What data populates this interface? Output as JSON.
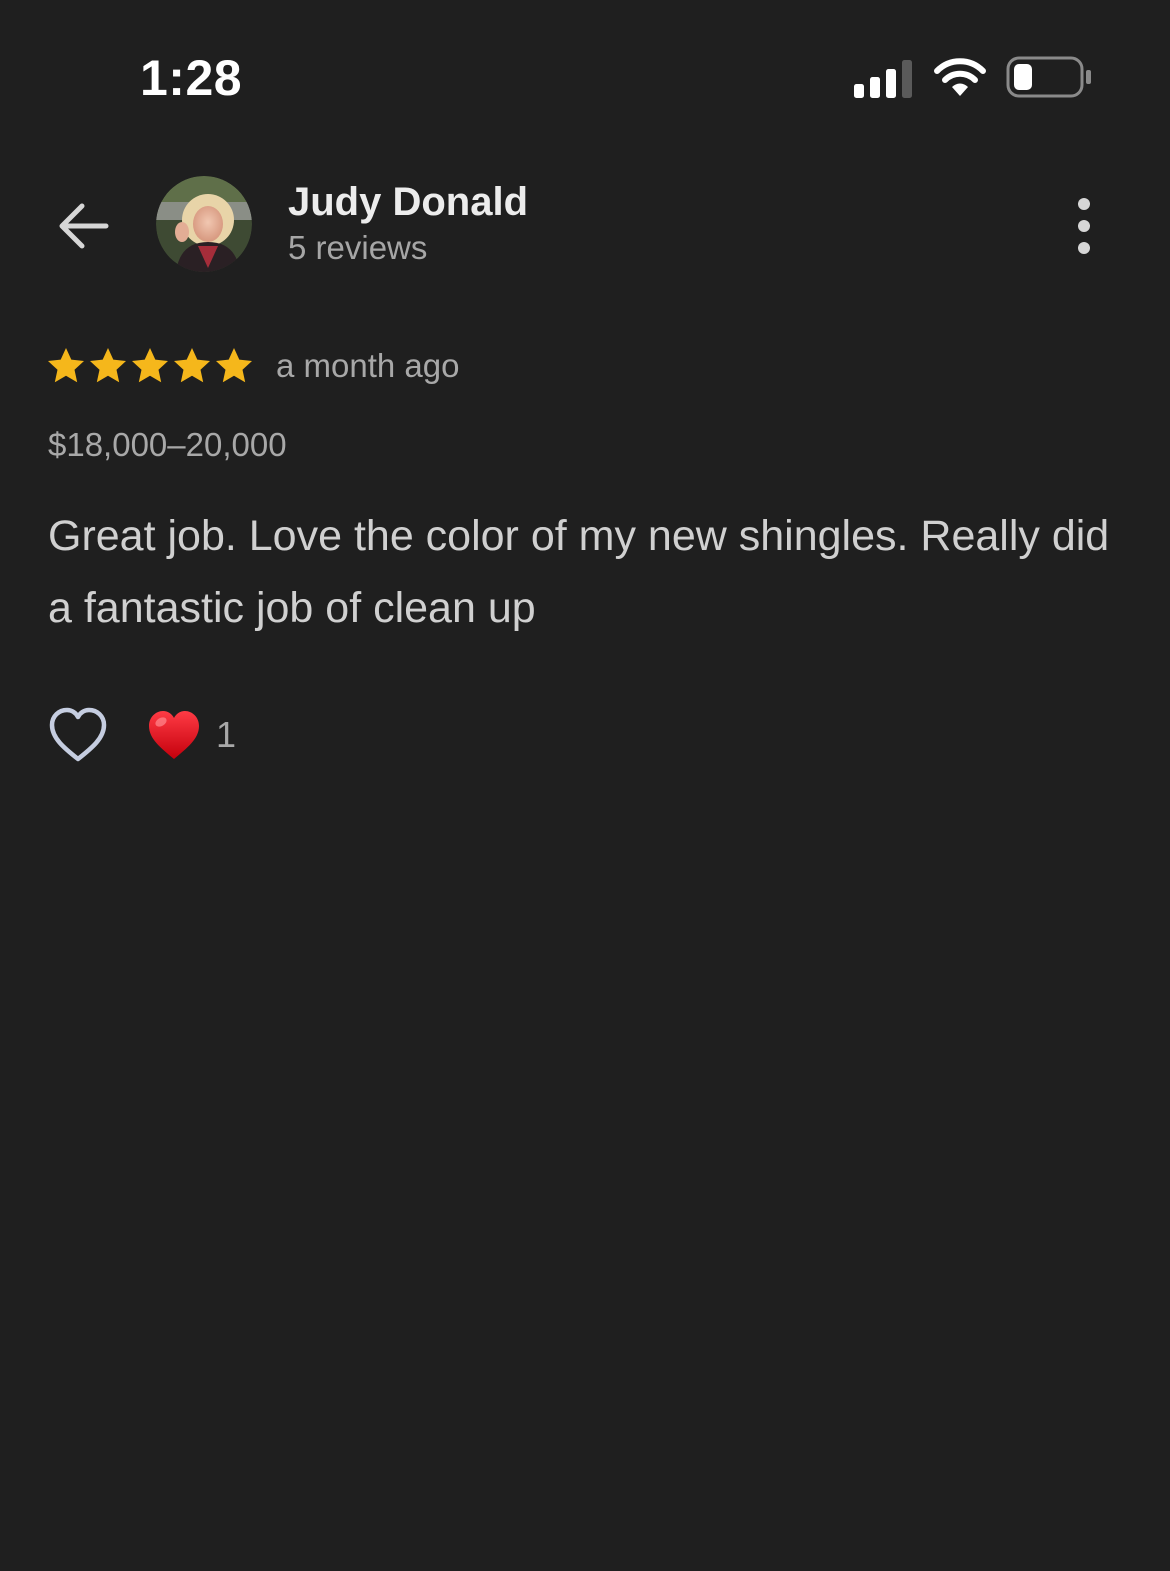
{
  "status_bar": {
    "time": "1:28",
    "icons": [
      "signal-icon",
      "wifi-icon",
      "battery-icon"
    ]
  },
  "header": {
    "back_icon": "arrow-left-icon",
    "reviewer_name": "Judy Donald",
    "review_count": "5 reviews",
    "more_icon": "more-vertical-icon"
  },
  "review": {
    "rating": 5,
    "rating_max": 5,
    "time_ago": "a month ago",
    "price_range": "$18,000–20,000",
    "text": "Great job. Love the color of my new shingles. Really did a fantastic job of clean up"
  },
  "actions": {
    "like_icon": "heart-outline-icon",
    "reaction_icon": "red-heart-icon",
    "reaction_count": "1"
  },
  "colors": {
    "background": "#1f1f1f",
    "star": "#f5b71b",
    "primary_text": "#ececec",
    "secondary_text": "#a8a8a8",
    "reaction_heart": "#e0101e"
  }
}
